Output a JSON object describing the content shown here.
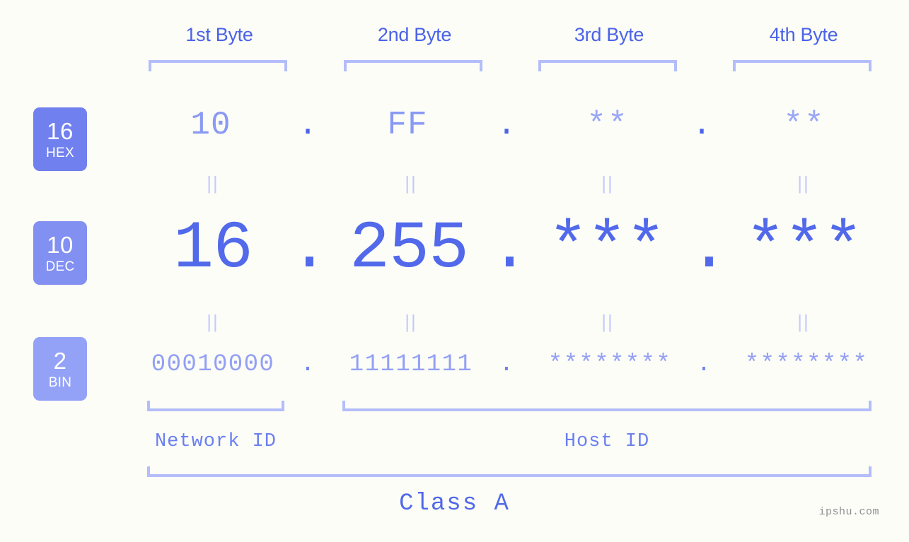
{
  "background_color": "#fcfdf7",
  "accent_color": "#5169ea",
  "bracket_color": "#b4bdfb",
  "header": {
    "bytes": [
      {
        "label": "1st Byte"
      },
      {
        "label": "2nd Byte"
      },
      {
        "label": "3rd Byte"
      },
      {
        "label": "4th Byte"
      }
    ]
  },
  "rows": [
    {
      "badge_number": "16",
      "badge_name": "HEX",
      "badge_color": "#7080ee",
      "values": [
        "10",
        "FF",
        "**",
        "**"
      ],
      "separators": [
        ".",
        ".",
        "."
      ]
    },
    {
      "badge_number": "10",
      "badge_name": "DEC",
      "badge_color": "#8190f1",
      "values": [
        "16",
        "255",
        "***",
        "***"
      ],
      "separators": [
        ".",
        ".",
        "."
      ]
    },
    {
      "badge_number": "2",
      "badge_name": "BIN",
      "badge_color": "#93a2f7",
      "values": [
        "00010000",
        "11111111",
        "********",
        "********"
      ],
      "separators": [
        ".",
        ".",
        "."
      ]
    }
  ],
  "equality_marks": {
    "symbol": "||",
    "count_per_row": 4
  },
  "footer": {
    "network_id_label": "Network ID",
    "host_id_label": "Host ID",
    "class_label": "Class A",
    "watermark": "ipshu.com"
  }
}
